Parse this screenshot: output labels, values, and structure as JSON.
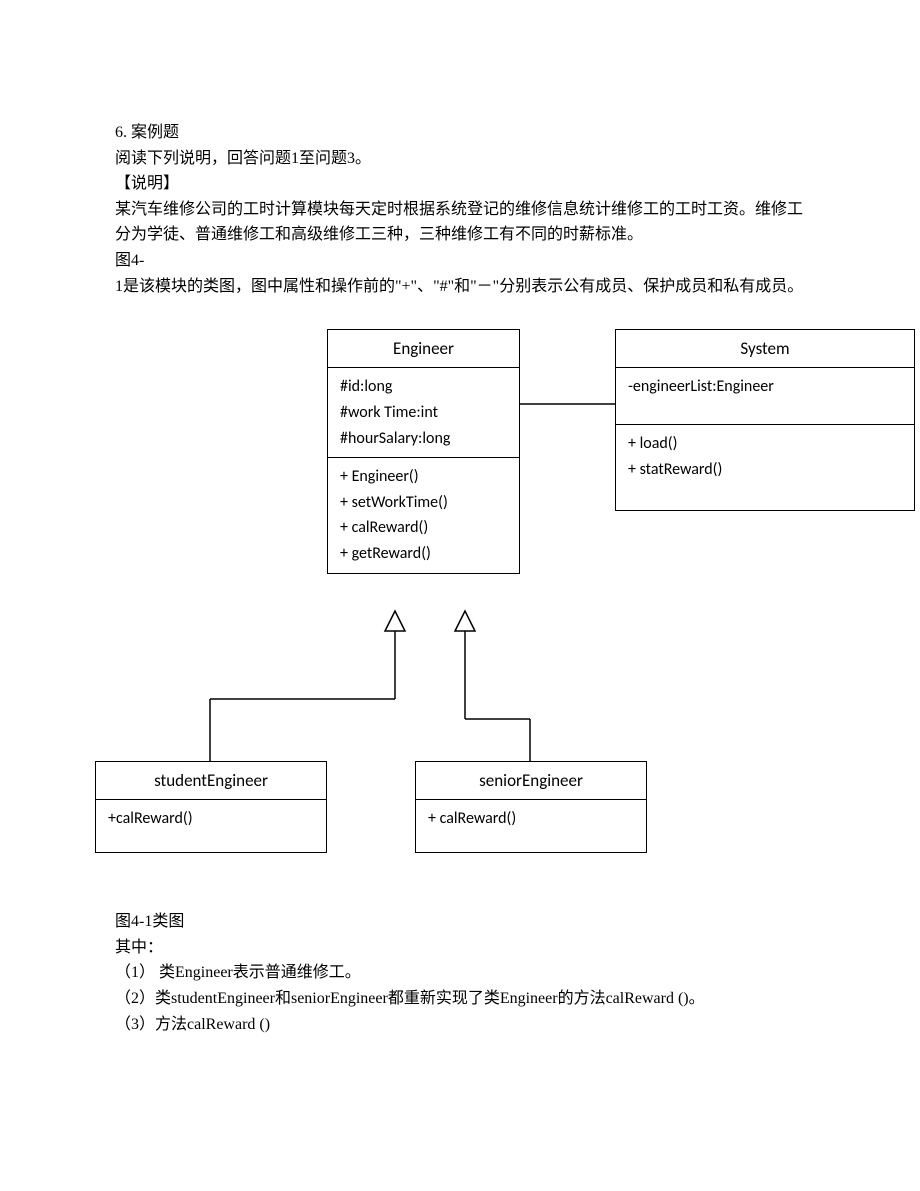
{
  "question": {
    "number": "6. 案例题",
    "instruction": "阅读下列说明，回答问题1至问题3。",
    "section_label": "【说明】",
    "desc1": "某汽车维修公司的工时计算模块每天定时根据系统登记的维修信息统计维修工的工时工资。维修工分为学徒、普通维修工和高级维修工三种，三种维修工有不同的时薪标准。",
    "fig_ref": "图4-",
    "desc2": "1是该模块的类图，图中属性和操作前的\"+\"、\"#\"和\"－\"分别表示公有成员、保护成员和私有成员。"
  },
  "classes": {
    "engineer": {
      "name": "Engineer",
      "attrs": [
        "#id:long",
        "#work Time:int",
        "#hourSalary:long"
      ],
      "ops": [
        "+ Engineer()",
        "+ setWorkTime()",
        "+ calReward()",
        "+ getReward()"
      ]
    },
    "system": {
      "name": "System",
      "attrs": [
        "-engineerList:Engineer"
      ],
      "ops": [
        "+ load()",
        "+ statReward()"
      ]
    },
    "student": {
      "name": "studentEngineer",
      "ops": [
        "+calReward()"
      ]
    },
    "senior": {
      "name": "seniorEngineer",
      "ops": [
        "+ calReward()"
      ]
    }
  },
  "footer": {
    "caption": "图4-1类图",
    "line0": "其中：",
    "line1": "（1） 类Engineer表示普通维修工。",
    "line2": "（2）类studentEngineer和seniorEngineer都重新实现了类Engineer的方法calReward ()。",
    "line3": "（3）方法calReward ()"
  }
}
